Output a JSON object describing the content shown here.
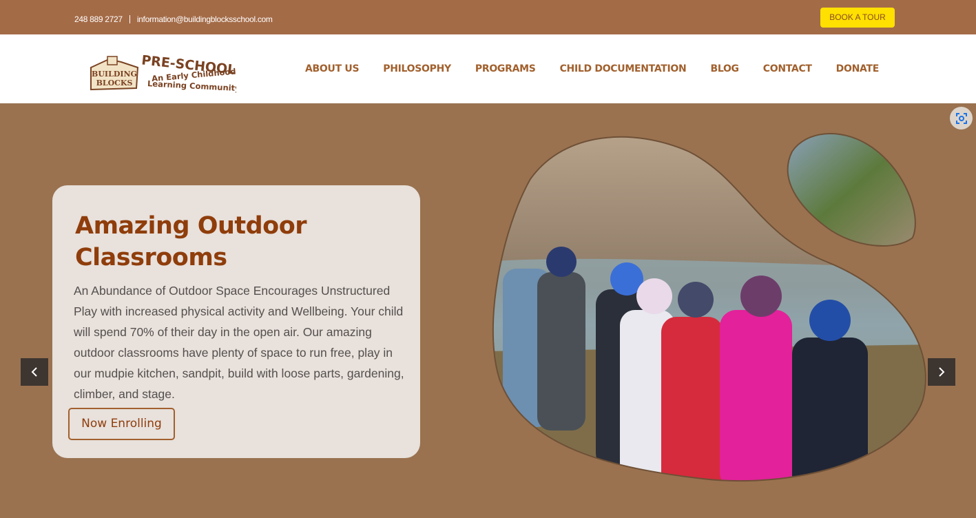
{
  "topbar": {
    "phone": "248 889 2727",
    "email": "information@buildingblocksschool.com",
    "book_label": "BOOK A TOUR"
  },
  "logo": {
    "text_main": "PRE-SCHOOL",
    "text_sub1": "An Early Childhood",
    "text_sub2": "Learning Community",
    "badge1": "BUILDING",
    "badge2": "BLOCKS"
  },
  "nav": {
    "items": [
      "ABOUT US",
      "PHILOSOPHY",
      "PROGRAMS",
      "CHILD DOCUMENTATION",
      "BLOG",
      "CONTACT",
      "DONATE"
    ]
  },
  "hero": {
    "title": "Amazing Outdoor Classrooms",
    "body": "An Abundance of Outdoor Space Encourages Unstructured Play with increased physical activity and Wellbeing. Your child will spend 70% of their day in the open air. Our amazing outdoor classrooms have plenty of space to run free, play in our mudpie kitchen, sandpit, build with loose parts, gardening, climber, and stage.",
    "button_label": "Now Enrolling",
    "prev_icon": "chevron-left-icon",
    "next_icon": "chevron-right-icon"
  },
  "colors": {
    "topbar": "#a46b47",
    "hero_bg": "#9a7250",
    "accent": "#ffe000",
    "brand_text": "#8f3d0b",
    "nav_text": "#a1602d"
  }
}
